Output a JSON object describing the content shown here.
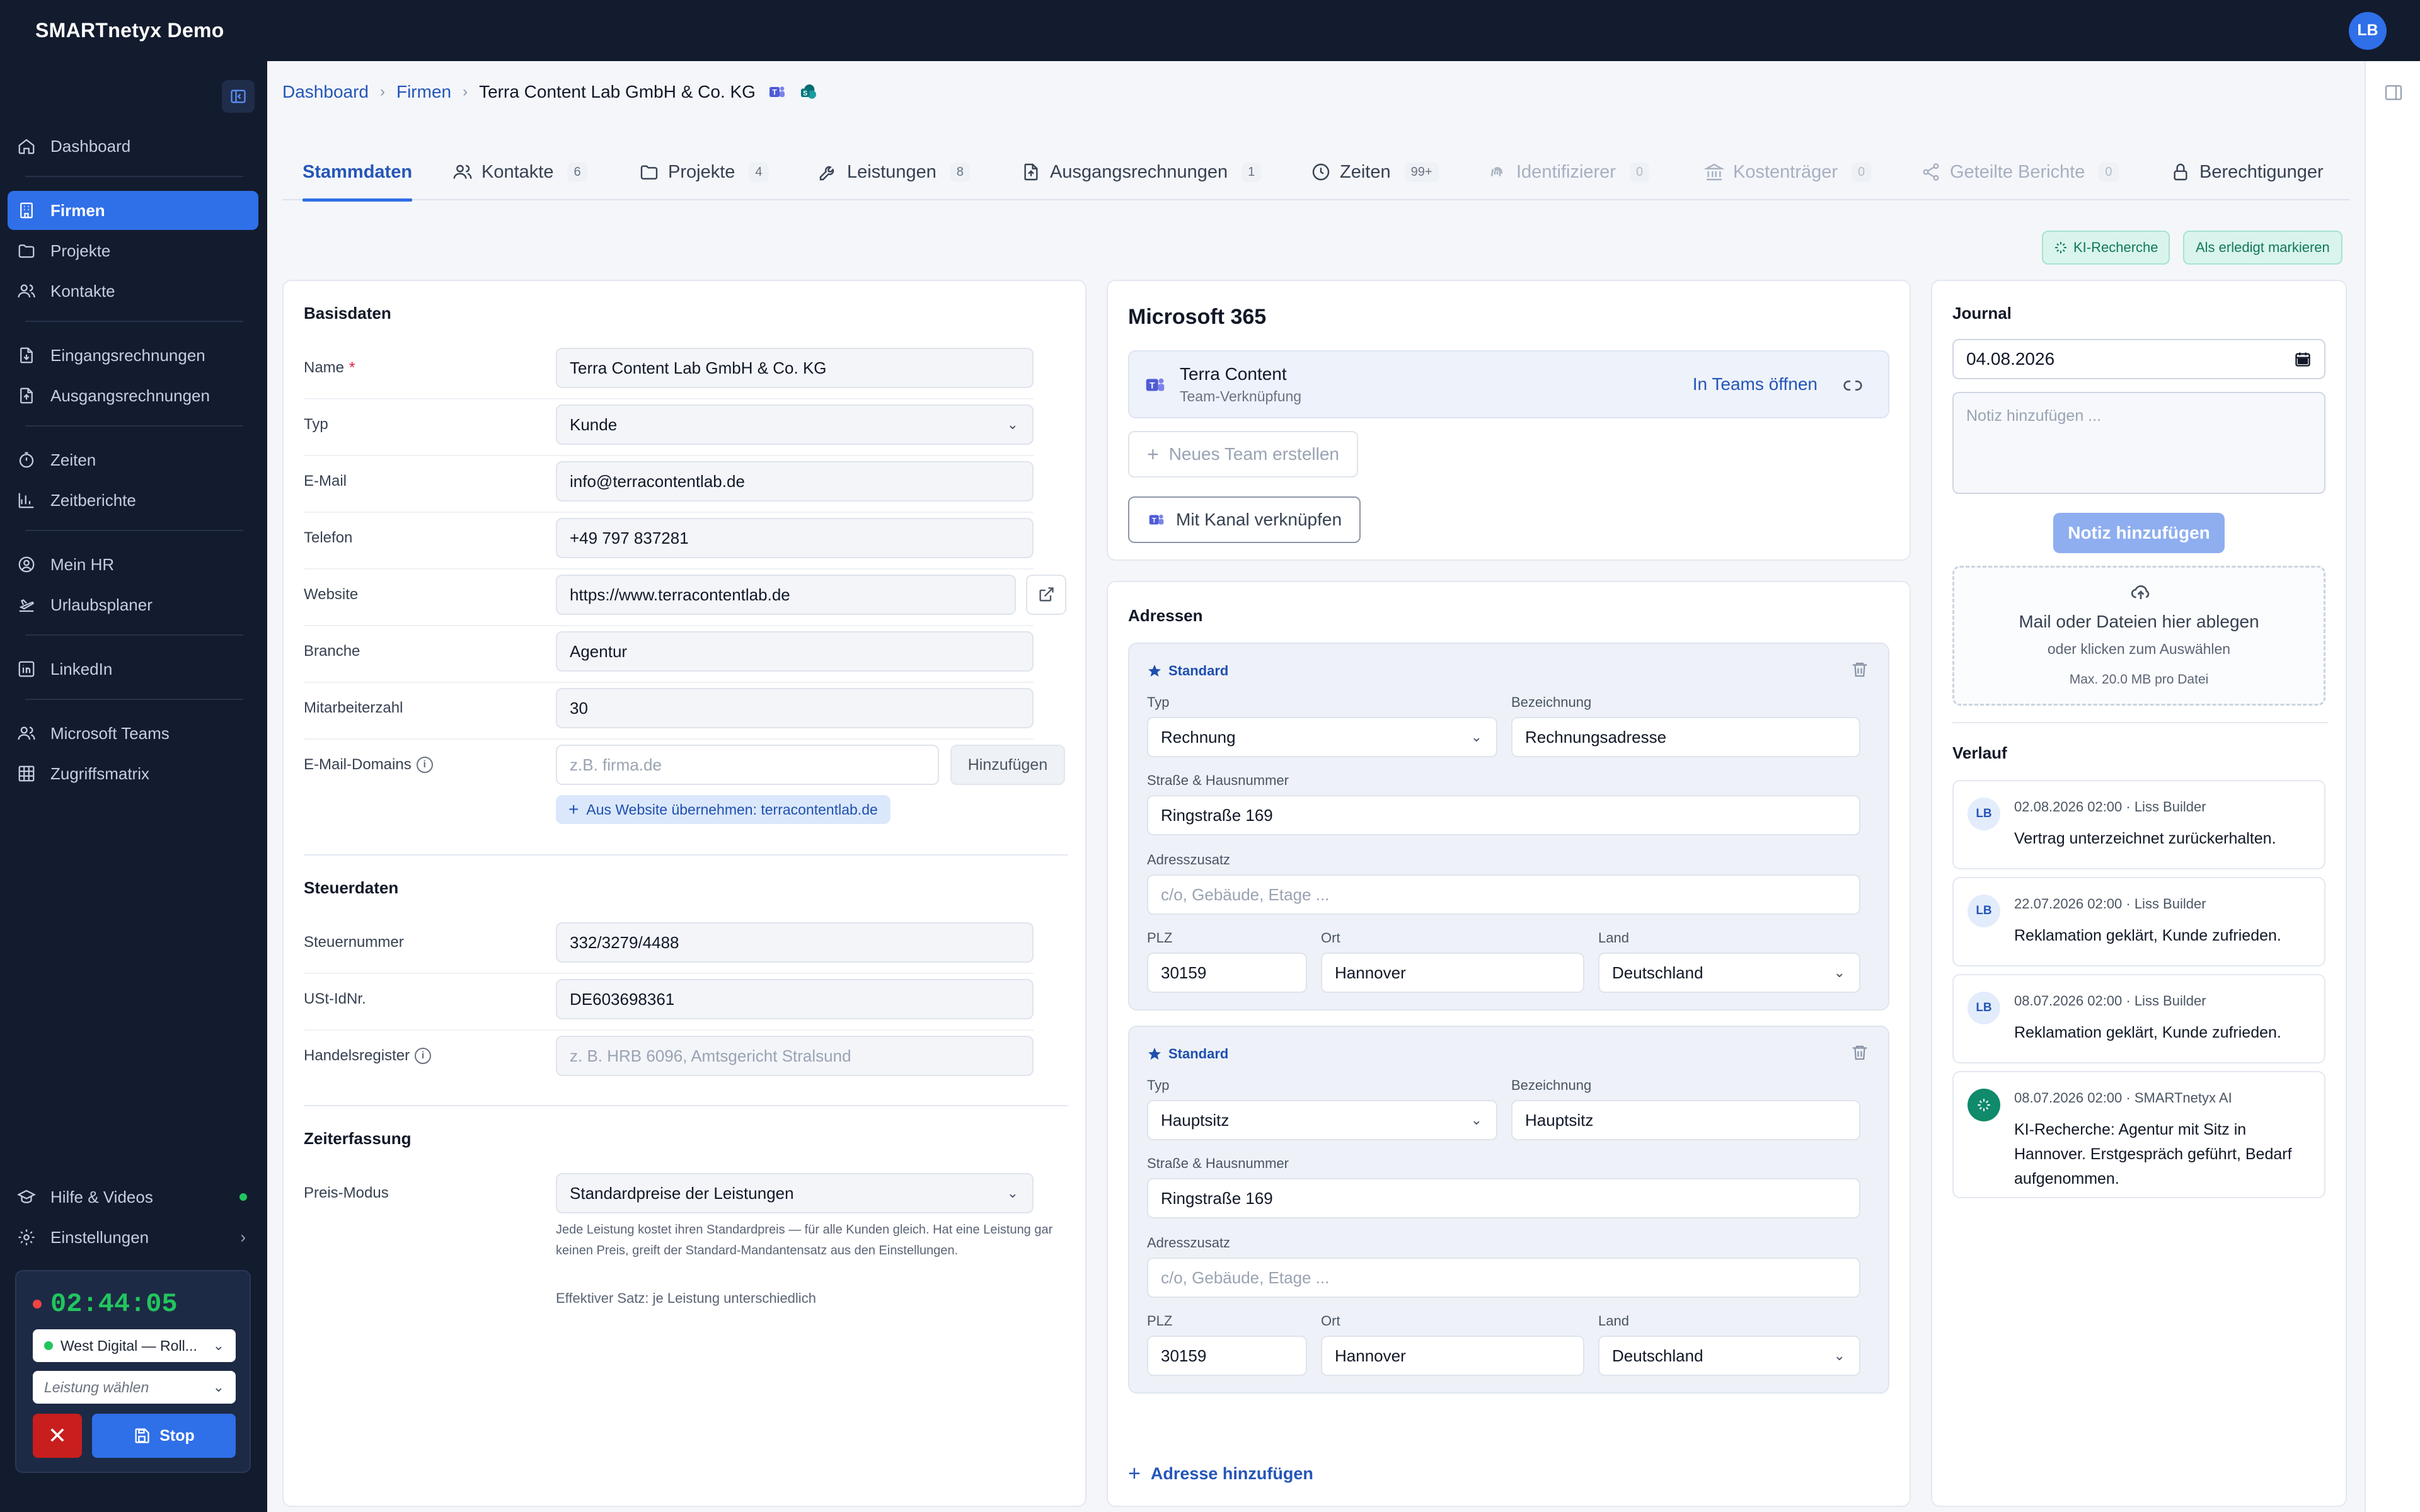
{
  "app": {
    "title": "SMARTnetyx Demo",
    "user_initials": "LB"
  },
  "sidebar": {
    "items": [
      {
        "label": "Dashboard"
      },
      {
        "label": "Firmen"
      },
      {
        "label": "Projekte"
      },
      {
        "label": "Kontakte"
      },
      {
        "label": "Eingangsrechnungen"
      },
      {
        "label": "Ausgangsrechnungen"
      },
      {
        "label": "Zeiten"
      },
      {
        "label": "Zeitberichte"
      },
      {
        "label": "Mein HR"
      },
      {
        "label": "Urlaubsplaner"
      },
      {
        "label": "LinkedIn"
      },
      {
        "label": "Microsoft Teams"
      },
      {
        "label": "Zugriffsmatrix"
      }
    ],
    "help_label": "Hilfe & Videos",
    "settings_label": "Einstellungen"
  },
  "timer": {
    "time": "02:44:05",
    "project": "West Digital — Roll...",
    "service_placeholder": "Leistung wählen",
    "stop_label": "Stop"
  },
  "breadcrumb": {
    "home": "Dashboard",
    "section": "Firmen",
    "current": "Terra Content Lab GmbH & Co. KG"
  },
  "tabs": [
    {
      "label": "Stammdaten",
      "count": ""
    },
    {
      "label": "Kontakte",
      "count": "6"
    },
    {
      "label": "Projekte",
      "count": "4"
    },
    {
      "label": "Leistungen",
      "count": "8"
    },
    {
      "label": "Ausgangsrechnungen",
      "count": "1"
    },
    {
      "label": "Zeiten",
      "count": "99+"
    },
    {
      "label": "Identifizierer",
      "count": "0"
    },
    {
      "label": "Kostenträger",
      "count": "0"
    },
    {
      "label": "Geteilte Berichte",
      "count": "0"
    },
    {
      "label": "Berechtigunger",
      "count": ""
    }
  ],
  "actions": {
    "ki_research": "KI-Recherche",
    "mark_done": "Als erledigt markieren"
  },
  "basisdaten": {
    "title": "Basisdaten",
    "name_label": "Name",
    "name": "Terra Content Lab GmbH & Co. KG",
    "typ_label": "Typ",
    "typ": "Kunde",
    "email_label": "E-Mail",
    "email": "info@terracontentlab.de",
    "telefon_label": "Telefon",
    "telefon": "+49 797 837281",
    "website_label": "Website",
    "website": "https://www.terracontentlab.de",
    "branche_label": "Branche",
    "branche": "Agentur",
    "mitarbeiter_label": "Mitarbeiterzahl",
    "mitarbeiter": "30",
    "domains_label": "E-Mail-Domains",
    "domains_placeholder": "z.B. firma.de",
    "add_label": "Hinzufügen",
    "from_website": "Aus Website übernehmen: terracontentlab.de"
  },
  "steuerdaten": {
    "title": "Steuerdaten",
    "steuernummer_label": "Steuernummer",
    "steuernummer": "332/3279/4488",
    "ust_label": "USt-IdNr.",
    "ust": "DE603698361",
    "hr_label": "Handelsregister",
    "hr_placeholder": "z. B. HRB 6096, Amtsgericht Stralsund"
  },
  "zeiterfassung": {
    "title": "Zeiterfassung",
    "preis_label": "Preis-Modus",
    "preis": "Standardpreise der Leistungen",
    "help": "Jede Leistung kostet ihren Standardpreis — für alle Kunden gleich. Hat eine Leistung gar keinen Preis, greift der Standard-Mandantensatz aus den Einstellungen.",
    "effective": "Effektiver Satz: je Leistung unterschiedlich"
  },
  "m365": {
    "title": "Microsoft 365",
    "team_name": "Terra Content",
    "team_sub": "Team-Verknüpfung",
    "open_teams": "In Teams öffnen",
    "new_team": "Neues Team erstellen",
    "link_channel": "Mit Kanal verknüpfen"
  },
  "adressen": {
    "title": "Adressen",
    "standard_label": "Standard",
    "typ_label": "Typ",
    "bez_label": "Bezeichnung",
    "street_label": "Straße & Hausnummer",
    "zusatz_label": "Adresszusatz",
    "zusatz_placeholder": "c/o, Gebäude, Etage ...",
    "plz_label": "PLZ",
    "ort_label": "Ort",
    "land_label": "Land",
    "items": [
      {
        "typ": "Rechnung",
        "bezeichnung": "Rechnungsadresse",
        "street": "Ringstraße 169",
        "plz": "30159",
        "ort": "Hannover",
        "land": "Deutschland"
      },
      {
        "typ": "Hauptsitz",
        "bezeichnung": "Hauptsitz",
        "street": "Ringstraße 169",
        "plz": "30159",
        "ort": "Hannover",
        "land": "Deutschland"
      }
    ],
    "add_label": "Adresse hinzufügen"
  },
  "journal": {
    "title": "Journal",
    "date": "04.08.2026",
    "note_placeholder": "Notiz hinzufügen ...",
    "add_note": "Notiz hinzufügen",
    "drop_title": "Mail oder Dateien hier ablegen",
    "drop_sub": "oder klicken zum Auswählen",
    "drop_max": "Max. 20.0 MB pro Datei",
    "history_title": "Verlauf",
    "history": [
      {
        "initials": "LB",
        "meta": "02.08.2026 02:00 · Liss Builder",
        "text": "Vertrag unterzeichnet zurückerhalten."
      },
      {
        "initials": "LB",
        "meta": "22.07.2026 02:00 · Liss Builder",
        "text": "Reklamation geklärt, Kunde zufrieden."
      },
      {
        "initials": "LB",
        "meta": "08.07.2026 02:00 · Liss Builder",
        "text": "Reklamation geklärt, Kunde zufrieden."
      },
      {
        "initials": "",
        "meta": "08.07.2026 02:00 · SMARTnetyx AI",
        "text": "KI-Recherche: Agentur mit Sitz in Hannover. Erstgespräch geführt, Bedarf aufgenommen."
      }
    ]
  }
}
